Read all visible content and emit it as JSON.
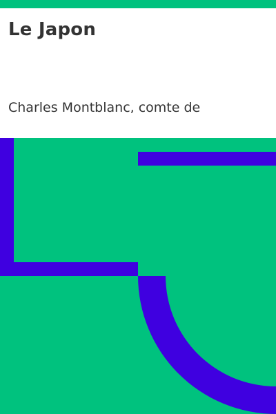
{
  "cover": {
    "title": "Le Japon",
    "author": "Charles Montblanc, comte de"
  },
  "colors": {
    "background": "#ffffff",
    "accent_green": "#00c27e",
    "accent_blue": "#3f00e0",
    "text": "#333333"
  }
}
